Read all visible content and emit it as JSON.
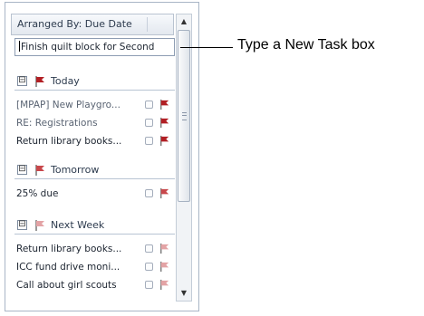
{
  "header": {
    "label": "Arranged By: Due Date"
  },
  "new_task": {
    "value": "Finish quilt block for Second"
  },
  "groups": [
    {
      "label": "Today",
      "collapse_symbol": "⊟",
      "flag_color": "#b21f24",
      "icon": "flag-icon",
      "tasks": [
        {
          "label": "[MPAP] New Playgro..."
        },
        {
          "label": "RE: Registrations"
        },
        {
          "label": "Return library books..."
        }
      ]
    },
    {
      "label": "Tomorrow",
      "collapse_symbol": "⊟",
      "flag_color": "#c8474b",
      "icon": "flag-icon",
      "tasks": [
        {
          "label": "25% due"
        }
      ]
    },
    {
      "label": "Next Week",
      "collapse_symbol": "⊟",
      "flag_color": "#e3a3a5",
      "icon": "flag-icon",
      "tasks": [
        {
          "label": "Return library books..."
        },
        {
          "label": "ICC fund drive moni..."
        },
        {
          "label": "Call about girl scouts"
        }
      ]
    }
  ],
  "callout": {
    "label": "Type a New Task box"
  },
  "scrollbar": {
    "up_arrow": "▲",
    "down_arrow": "▼"
  }
}
